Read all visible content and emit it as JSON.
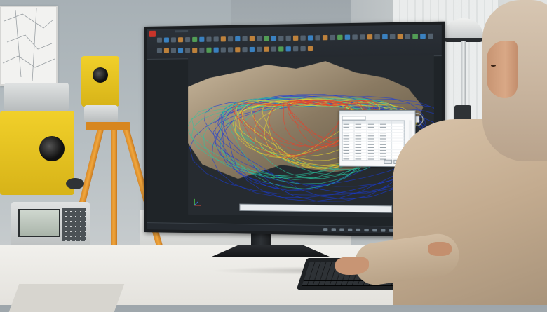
{
  "scene": {
    "description_visible_text": "",
    "software": {
      "ribbon_tabs": [
        "",
        "",
        "",
        "",
        "",
        "",
        "",
        ""
      ],
      "tree_items": [
        "",
        "",
        "",
        "",
        "",
        "",
        "",
        "",
        "",
        "",
        "",
        "",
        "",
        "",
        "",
        "",
        "",
        "",
        "",
        "",
        "",
        "",
        "",
        "",
        "",
        "",
        "",
        "",
        "",
        "",
        "",
        "",
        "",
        "",
        "",
        "",
        ""
      ],
      "dialog_columns": [
        "",
        "",
        "",
        "",
        ""
      ],
      "dialog_rows": 16
    },
    "colors": {
      "tripod_orange": "#f2a73c",
      "instrument_yellow": "#f1d02a",
      "ui_dark": "#252a30",
      "terrain_low": "#1a3cd8",
      "terrain_mid": "#29c7a0",
      "terrain_high": "#e8d430",
      "terrain_peak": "#e8402a"
    },
    "icons": [
      "app-logo-icon",
      "viewcube-icon",
      "axis-icon"
    ]
  }
}
